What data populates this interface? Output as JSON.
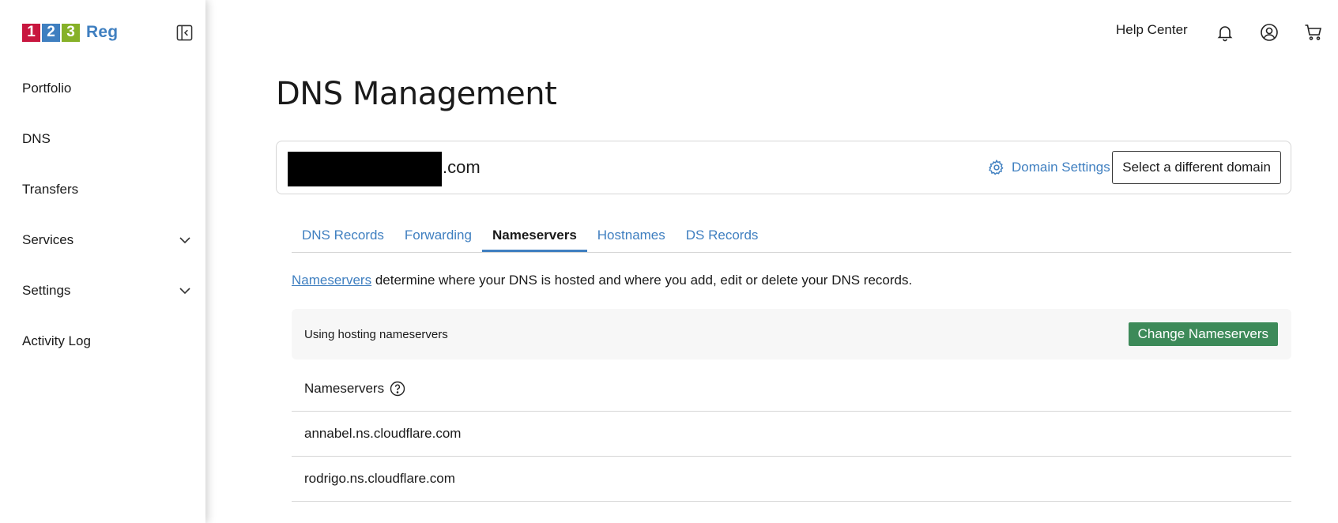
{
  "brand": {
    "digits": [
      "1",
      "2",
      "3"
    ],
    "digit_colors": [
      "#c8163f",
      "#3f7fc0",
      "#86b128"
    ],
    "suffix": "Reg"
  },
  "sidebar": {
    "items": [
      {
        "label": "Portfolio",
        "expandable": false
      },
      {
        "label": "DNS",
        "expandable": false
      },
      {
        "label": "Transfers",
        "expandable": false
      },
      {
        "label": "Services",
        "expandable": true
      },
      {
        "label": "Settings",
        "expandable": true
      },
      {
        "label": "Activity Log",
        "expandable": false
      }
    ]
  },
  "topbar": {
    "help_label": "Help Center",
    "icons": [
      "bell-icon",
      "user-icon",
      "cart-icon"
    ]
  },
  "page": {
    "title": "DNS Management"
  },
  "domain": {
    "visible_suffix": ".com",
    "settings_label": "Domain Settings",
    "select_button": "Select a different domain"
  },
  "tabs": [
    {
      "label": "DNS Records",
      "active": false
    },
    {
      "label": "Forwarding",
      "active": false
    },
    {
      "label": "Nameservers",
      "active": true
    },
    {
      "label": "Hostnames",
      "active": false
    },
    {
      "label": "DS Records",
      "active": false
    }
  ],
  "nameservers": {
    "intro_link": "Nameservers",
    "intro_text": " determine where your DNS is hosted and where you add, edit or delete your DNS records.",
    "status_text": "Using hosting nameservers",
    "change_button": "Change Nameservers",
    "list_header": "Nameservers",
    "list": [
      "annabel.ns.cloudflare.com",
      "rodrigo.ns.cloudflare.com"
    ]
  },
  "colors": {
    "accent": "#3f7fc0",
    "button_green": "#3d8a59"
  }
}
